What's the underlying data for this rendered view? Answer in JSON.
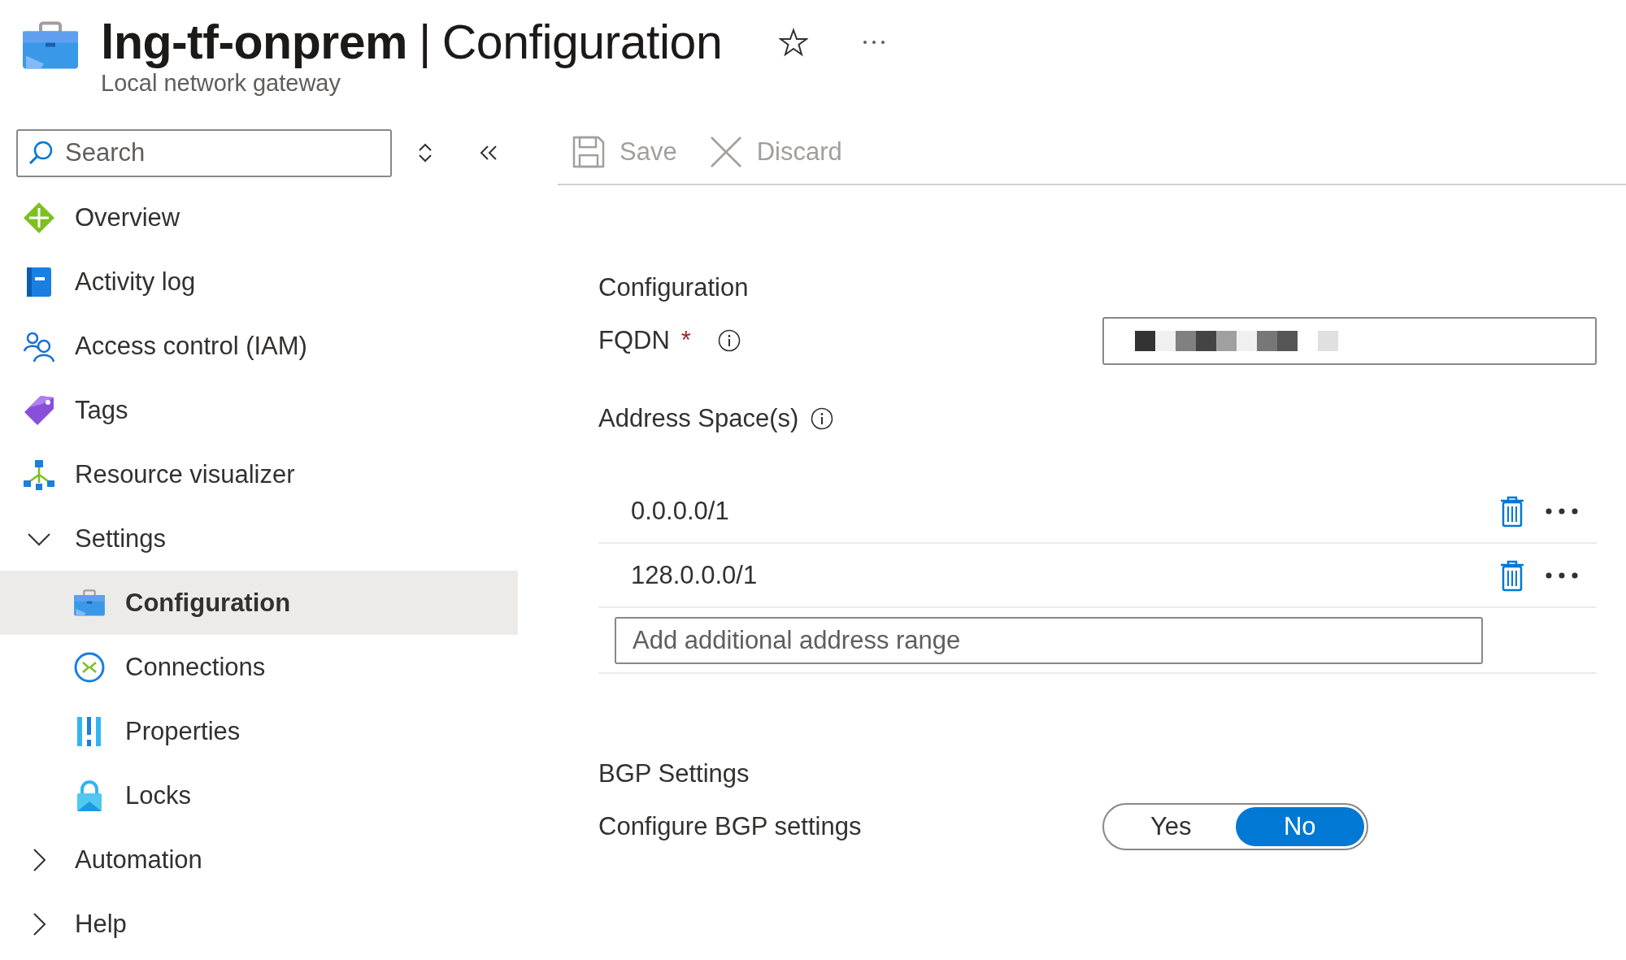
{
  "header": {
    "resource": "lng-tf-onprem",
    "separator": "|",
    "page": "Configuration",
    "subtitle": "Local network gateway",
    "favorite": false
  },
  "sidebar": {
    "search": {
      "placeholder": "Search"
    },
    "items": [
      {
        "label": "Overview",
        "selected": false
      },
      {
        "label": "Activity log",
        "selected": false
      },
      {
        "label": "Access control (IAM)",
        "selected": false
      },
      {
        "label": "Tags",
        "selected": false
      },
      {
        "label": "Resource visualizer",
        "selected": false
      },
      {
        "label": "Settings",
        "selected": false,
        "expanded": true,
        "children": [
          {
            "label": "Configuration",
            "selected": true
          },
          {
            "label": "Connections",
            "selected": false
          },
          {
            "label": "Properties",
            "selected": false
          },
          {
            "label": "Locks",
            "selected": false
          }
        ]
      },
      {
        "label": "Automation",
        "selected": false,
        "expanded": false
      },
      {
        "label": "Help",
        "selected": false,
        "expanded": false
      }
    ]
  },
  "toolbar": [
    {
      "kind": "save",
      "label": "Save",
      "disabled": true
    },
    {
      "kind": "discard",
      "label": "Discard",
      "disabled": true
    }
  ],
  "configuration": {
    "title": "Configuration",
    "fqdn": {
      "label": "FQDN",
      "required_mark": "*"
    },
    "address_space": {
      "label": "Address Space(s)",
      "rows": [
        {
          "value": "0.0.0.0/1"
        },
        {
          "value": "128.0.0.0/1"
        }
      ],
      "placeholder": "Add additional address range"
    }
  },
  "bgp": {
    "title": "BGP Settings",
    "label": "Configure BGP settings",
    "options": [
      {
        "label": "Yes",
        "selected": false
      },
      {
        "label": "No",
        "selected": true
      }
    ]
  }
}
